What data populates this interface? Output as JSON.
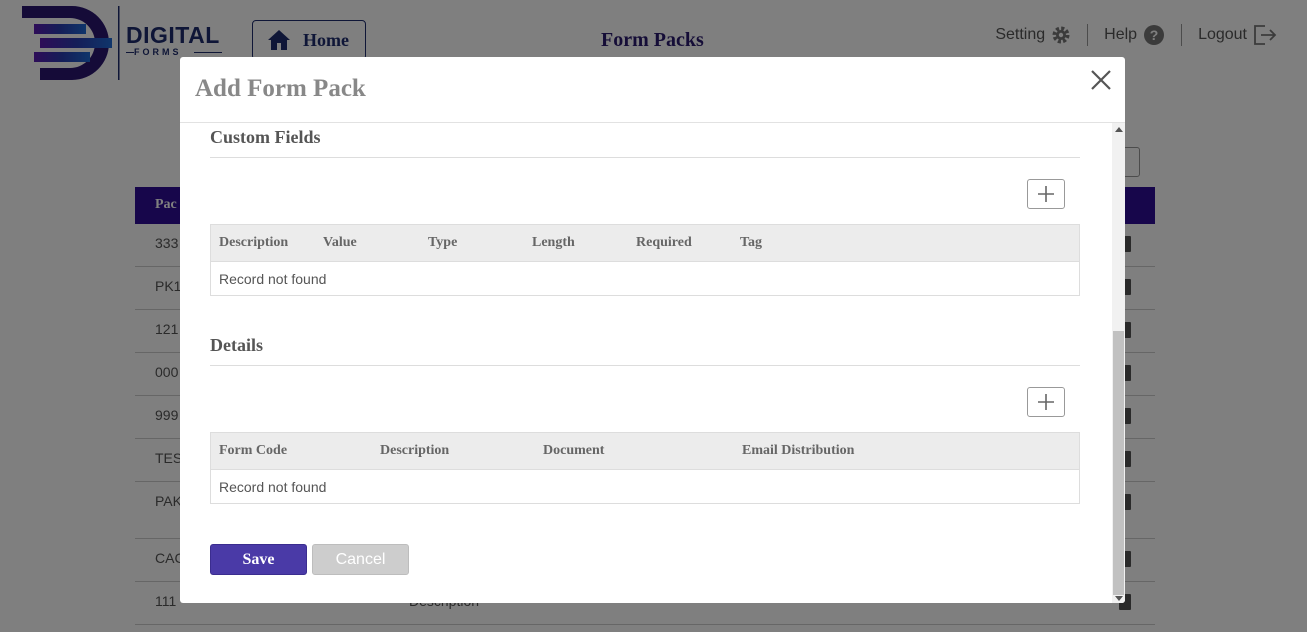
{
  "app": {
    "logo_text": "DIGITAL",
    "logo_subtext": "FORMS",
    "home_label": "Home",
    "page_title": "Form Packs",
    "nav": {
      "setting": "Setting",
      "help": "Help",
      "logout": "Logout"
    }
  },
  "background_table": {
    "header_label": "Pac",
    "rows": [
      "333",
      "PK1",
      "121",
      "000",
      "999",
      "TES",
      "PAK",
      "CAC",
      "111"
    ],
    "last_row_desc": "Description"
  },
  "modal": {
    "title": "Add Form Pack",
    "custom_fields": {
      "title": "Custom Fields",
      "columns": [
        "Description",
        "Value",
        "Type",
        "Length",
        "Required",
        "Tag"
      ],
      "empty_text": "Record not found"
    },
    "details": {
      "title": "Details",
      "columns": [
        "Form Code",
        "Description",
        "Document",
        "Email Distribution"
      ],
      "empty_text": "Record not found"
    },
    "save_label": "Save",
    "cancel_label": "Cancel"
  },
  "colors": {
    "brand": "#1f2d6e",
    "table_header": "#2e0d96",
    "save_button": "#4a3aa7",
    "cancel_button": "#cdcdcd"
  }
}
